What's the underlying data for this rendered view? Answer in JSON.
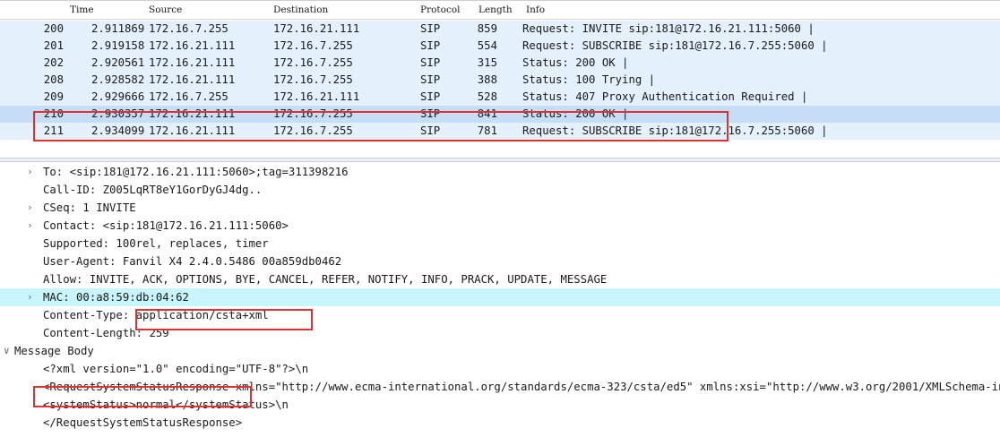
{
  "packet_list": {
    "columns": [
      "Time",
      "Source",
      "Destination",
      "Protocol",
      "Length",
      "Info"
    ],
    "rows": [
      {
        "no": "200",
        "time": "2.911869",
        "source": "172.16.7.255",
        "destination": "172.16.21.111",
        "protocol": "SIP",
        "length": "859",
        "info": "Request: INVITE sip:181@172.16.21.111:5060 |",
        "selected": false
      },
      {
        "no": "201",
        "time": "2.919158",
        "source": "172.16.21.111",
        "destination": "172.16.7.255",
        "protocol": "SIP",
        "length": "554",
        "info": "Request: SUBSCRIBE sip:181@172.16.7.255:5060 |",
        "selected": false
      },
      {
        "no": "202",
        "time": "2.920561",
        "source": "172.16.21.111",
        "destination": "172.16.7.255",
        "protocol": "SIP",
        "length": "315",
        "info": "Status: 200 OK |",
        "selected": false
      },
      {
        "no": "208",
        "time": "2.928582",
        "source": "172.16.21.111",
        "destination": "172.16.7.255",
        "protocol": "SIP",
        "length": "388",
        "info": "Status: 100 Trying |",
        "selected": false
      },
      {
        "no": "209",
        "time": "2.929666",
        "source": "172.16.7.255",
        "destination": "172.16.21.111",
        "protocol": "SIP",
        "length": "528",
        "info": "Status: 407 Proxy Authentication Required |",
        "selected": false
      },
      {
        "no": "210",
        "time": "2.930357",
        "source": "172.16.21.111",
        "destination": "172.16.7.255",
        "protocol": "SIP",
        "length": "841",
        "info": "Status: 200 OK |",
        "selected": true
      },
      {
        "no": "211",
        "time": "2.934099",
        "source": "172.16.21.111",
        "destination": "172.16.7.255",
        "protocol": "SIP",
        "length": "781",
        "info": "Request: SUBSCRIBE sip:181@172.16.7.255:5060 |",
        "selected": false
      }
    ]
  },
  "details": [
    {
      "text": "To: <sip:181@172.16.21.111:5060>;tag=311398216",
      "expander": "collapsed",
      "indent": 1,
      "highlight": false
    },
    {
      "text": "Call-ID: Z005LqRT8eY1GorDyGJ4dg..",
      "expander": "none",
      "indent": 1,
      "highlight": false
    },
    {
      "text": "CSeq: 1 INVITE",
      "expander": "collapsed",
      "indent": 1,
      "highlight": false
    },
    {
      "text": "Contact: <sip:181@172.16.21.111:5060>",
      "expander": "collapsed",
      "indent": 1,
      "highlight": false
    },
    {
      "text": "Supported: 100rel, replaces, timer",
      "expander": "none",
      "indent": 1,
      "highlight": false
    },
    {
      "text": "User-Agent: Fanvil X4 2.4.0.5486 00a859db0462",
      "expander": "none",
      "indent": 1,
      "highlight": false
    },
    {
      "text": "Allow: INVITE, ACK, OPTIONS, BYE, CANCEL, REFER, NOTIFY, INFO, PRACK, UPDATE, MESSAGE",
      "expander": "none",
      "indent": 1,
      "highlight": false
    },
    {
      "text": "MAC: 00:a8:59:db:04:62",
      "expander": "collapsed",
      "indent": 1,
      "highlight": true
    },
    {
      "text": "Content-Type: application/csta+xml",
      "expander": "none",
      "indent": 1,
      "highlight": false
    },
    {
      "text": "Content-Length: 259",
      "expander": "none",
      "indent": 1,
      "highlight": false
    },
    {
      "text": "Message Body",
      "expander": "expanded",
      "indent": 0,
      "highlight": false
    },
    {
      "text": "<?xml version=\"1.0\" encoding=\"UTF-8\"?>\\n",
      "expander": "none",
      "indent": 1,
      "highlight": false
    },
    {
      "text": "<RequestSystemStatusResponse xmlns=\"http://www.ecma-international.org/standards/ecma-323/csta/ed5\" xmlns:xsi=\"http://www.w3.org/2001/XMLSchema-instance\">\\n",
      "expander": "none",
      "indent": 1,
      "highlight": false
    },
    {
      "text": "<systemStatus>normal</systemStatus>\\n",
      "expander": "none",
      "indent": 1,
      "highlight": false
    },
    {
      "text": "</RequestSystemStatusResponse>",
      "expander": "none",
      "indent": 1,
      "highlight": false
    }
  ],
  "colors": {
    "sip_row": "#e4f0fc",
    "selected_row": "#c5def6",
    "highlight_line": "#c8f4fb",
    "annotation": "#e03030"
  }
}
